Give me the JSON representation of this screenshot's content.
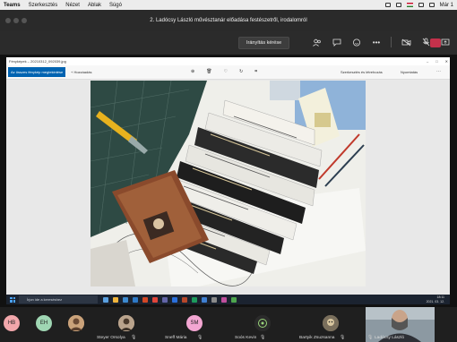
{
  "menubar": {
    "items": [
      "Teams",
      "Szerkesztés",
      "Nézet",
      "Ablak",
      "Súgó"
    ],
    "clock": "Már 1"
  },
  "window": {
    "title": "2. Ladócsy László művésztanár előadása festészetről, irodalomról"
  },
  "toolbar": {
    "control_label": "Irányítás kérése",
    "icons": [
      "participants-icon",
      "chat-icon",
      "reactions-icon",
      "more-icon",
      "camera-off-icon",
      "mic-off-icon",
      "share-icon"
    ]
  },
  "viewer": {
    "filename": "Fényképek – 20210312_092039.jpg",
    "open_button": "Az összes fénykép megtekintése",
    "add_label": "+  Hozzáadás",
    "edit_label": "Szerkesztés és létrehozás",
    "print_label": "Nyomtatás"
  },
  "taskbar": {
    "search_placeholder": "Írjon ide a kereséshez",
    "time": "18:11",
    "date": "2021. 03. 12."
  },
  "participants": [
    {
      "initials": "HB",
      "color": "#f2a7ab"
    },
    {
      "initials": "EH",
      "color": "#9fd6b3"
    },
    {
      "initials": "",
      "color": "#caa27a"
    },
    {
      "name": "Steyer Orsolya",
      "color": "#b9a38c"
    },
    {
      "initials": "SM",
      "name": "Sneff Mária",
      "color": "#f3a6d2"
    },
    {
      "name": "Soós Kevin",
      "color": "#2b2b2b"
    },
    {
      "name": "Bartyik Zsuzsanna",
      "color": "#7a6f5c"
    },
    {
      "name": "Ladócsy László"
    }
  ]
}
